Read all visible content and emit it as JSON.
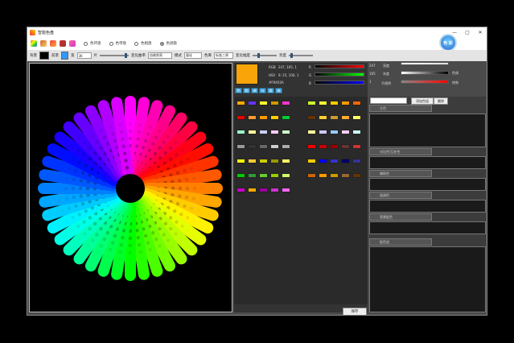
{
  "window": {
    "title": "智能色盘",
    "minimize": "—",
    "maximize": "▢",
    "close": "✕"
  },
  "toolbar1": {
    "radios": [
      {
        "label": "色环盘",
        "checked": false
      },
      {
        "label": "色带盘",
        "checked": false
      },
      {
        "label": "色相盘",
        "checked": false
      },
      {
        "label": "色调盘",
        "checked": true
      }
    ],
    "logo_text": "色 彩"
  },
  "toolbar2": {
    "bg_label": "背景",
    "fg_label": "前景",
    "size_label": "宽",
    "size_value": "36",
    "count_label": "片",
    "lens_label": "变化曲率",
    "lens_value": "由暗到亮",
    "mode_label": "模式",
    "mode_value": "量化",
    "color_label": "色库",
    "color_value": "标准三原",
    "strength_label": "变化幅度",
    "brightness_label": "亮度"
  },
  "controls": {
    "rgb_label": "RGB",
    "rgb_value": "247, 165, 1",
    "hsv_label": "HSV",
    "hsv_value": "9: 25, 100, 1",
    "hex_value": "#F9A50A",
    "r_value": "247",
    "g_value": "165",
    "b_value": "1",
    "r_letter": "R",
    "g_letter": "G",
    "b_letter": "B",
    "bright_label": "亮度",
    "sat_label": "饱和",
    "hue_label": "色调",
    "gray_label": "灰度",
    "opacity_label": "不透明"
  },
  "palette_tabs": [
    "色",
    "相",
    "调",
    "分",
    "类",
    "选"
  ],
  "size_button": "保存",
  "right": {
    "input_value": "",
    "add_button": "添加色组",
    "delete_button": "删除",
    "sections": [
      {
        "title": "主色"
      },
      {
        "title": "对比色/互补色"
      },
      {
        "title": "辅助色"
      },
      {
        "title": "强调色"
      },
      {
        "title": "背景配色"
      },
      {
        "title": "配色组"
      }
    ]
  },
  "colors": {
    "window_bg": "#4a4a4a",
    "selected": "#f9a50a",
    "titlebar": "#ffffff"
  }
}
